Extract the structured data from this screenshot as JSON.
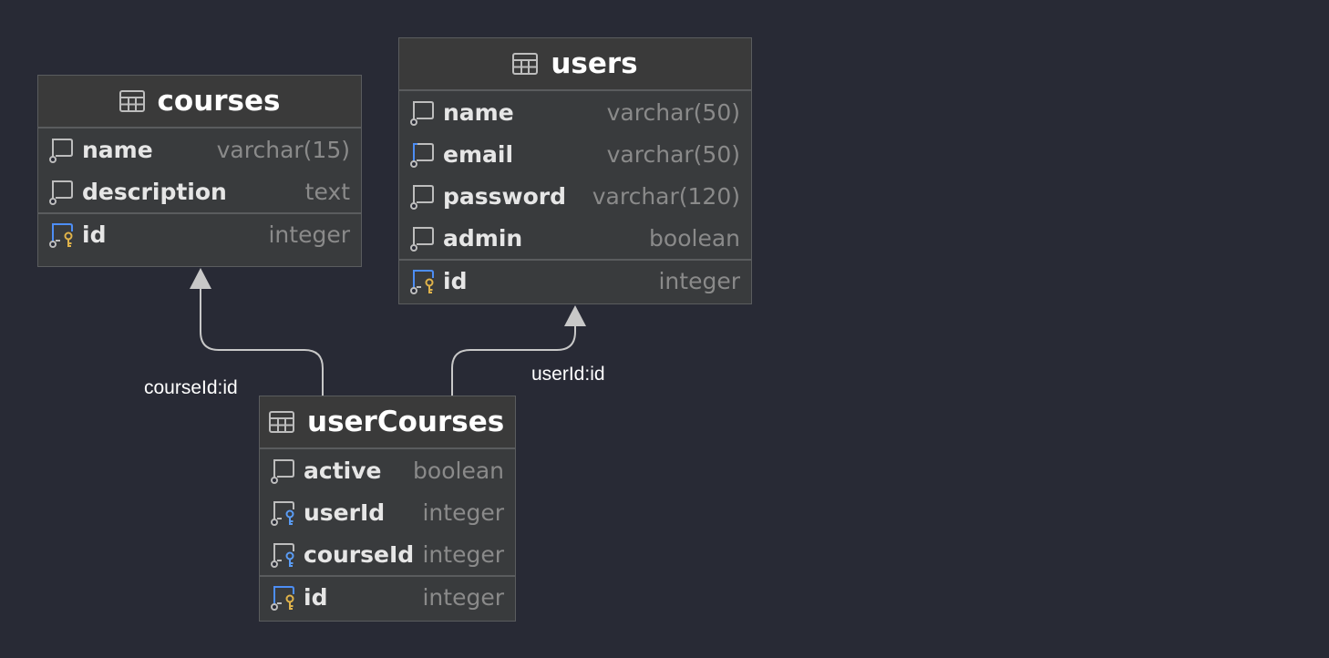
{
  "tables": [
    {
      "id": "courses",
      "name": "courses",
      "columns": [
        {
          "name": "name",
          "type": "varchar(15)",
          "icon": "column-icon"
        },
        {
          "name": "description",
          "type": "text",
          "icon": "column-icon"
        }
      ],
      "key_columns": [
        {
          "name": "id",
          "type": "integer",
          "icon": "primary-key-icon"
        }
      ]
    },
    {
      "id": "users",
      "name": "users",
      "columns": [
        {
          "name": "name",
          "type": "varchar(50)",
          "icon": "column-icon"
        },
        {
          "name": "email",
          "type": "varchar(50)",
          "icon": "unique-column-icon"
        },
        {
          "name": "password",
          "type": "varchar(120)",
          "icon": "column-icon"
        },
        {
          "name": "admin",
          "type": "boolean",
          "icon": "column-icon"
        }
      ],
      "key_columns": [
        {
          "name": "id",
          "type": "integer",
          "icon": "primary-key-icon"
        }
      ]
    },
    {
      "id": "userCourses",
      "name": "userCourses",
      "columns": [
        {
          "name": "active",
          "type": "boolean",
          "icon": "column-icon"
        },
        {
          "name": "userId",
          "type": "integer",
          "icon": "foreign-key-icon"
        },
        {
          "name": "courseId",
          "type": "integer",
          "icon": "foreign-key-icon"
        }
      ],
      "key_columns": [
        {
          "name": "id",
          "type": "integer",
          "icon": "primary-key-icon"
        }
      ]
    }
  ],
  "relations": [
    {
      "from": "userCourses",
      "to": "courses",
      "label": "courseId:id"
    },
    {
      "from": "userCourses",
      "to": "users",
      "label": "userId:id"
    }
  ],
  "colors": {
    "background": "#282a35",
    "table_body": "#393b3d",
    "table_header": "#3a3a3a",
    "border": "#5a5c5e",
    "connector": "#c8c8c8",
    "icon_stroke": "#bdbdbd",
    "unique_accent": "#4d8ef5",
    "primary_key": "#e0b34a",
    "foreign_key": "#5a9cf5"
  }
}
